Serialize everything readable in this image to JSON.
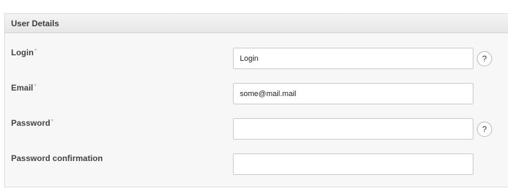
{
  "panel": {
    "title": "User Details"
  },
  "form": {
    "required_marker": "*",
    "help_symbol": "?",
    "login": {
      "label": "Login",
      "value": "Login",
      "required": true
    },
    "email": {
      "label": "Email",
      "value": "some@mail.mail",
      "required": true
    },
    "password": {
      "label": "Password",
      "value": "",
      "required": true
    },
    "password_confirmation": {
      "label": "Password confirmation",
      "value": "",
      "required": false
    }
  }
}
